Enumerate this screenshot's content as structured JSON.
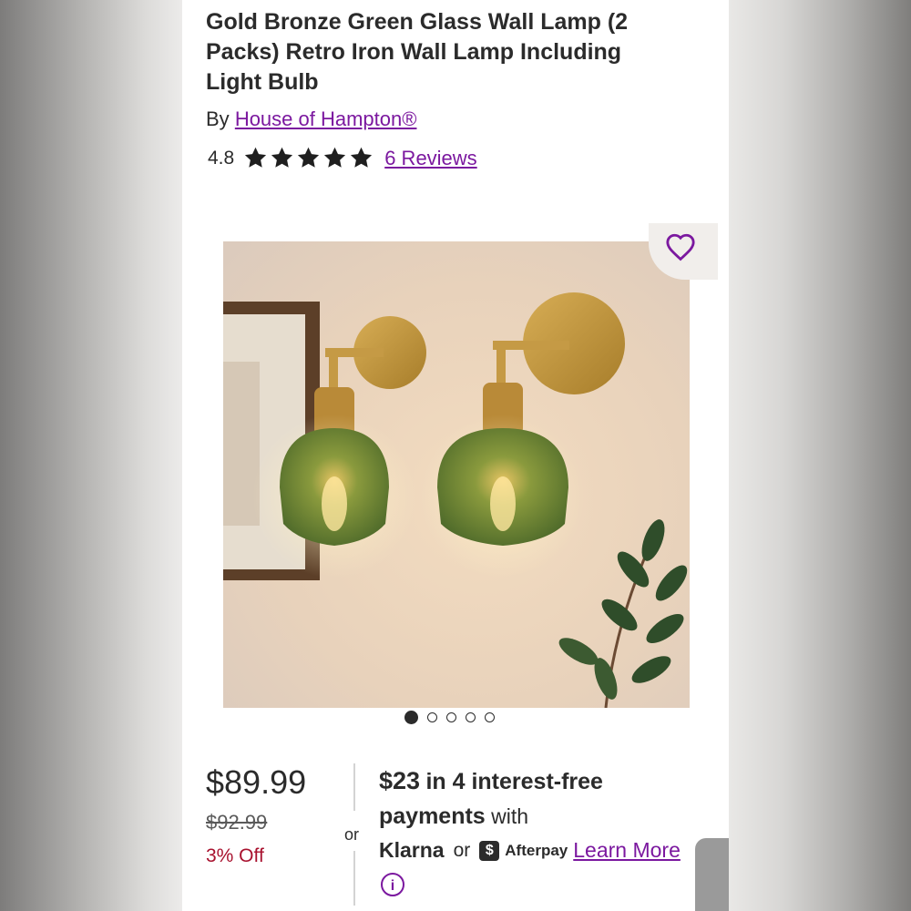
{
  "product": {
    "title": "Gold Bronze Green Glass Wall Lamp (2 Packs) Retro Iron Wall Lamp Including Light Bulb",
    "by_label": "By",
    "brand": "House of Hampton®",
    "rating": "4.8",
    "star_count": 5,
    "reviews_link": "6 Reviews"
  },
  "gallery": {
    "image_count": 5,
    "active_index": 0
  },
  "pricing": {
    "price": "$89.99",
    "old_price": "$92.99",
    "discount": "3% Off",
    "or_label": "or",
    "installment_amount": "$23",
    "installment_text_1": "in 4 interest-free",
    "installment_text_2": "payments",
    "installment_text_3": "with",
    "klarna": "Klarna",
    "or2": "or",
    "afterpay": "Afterpay",
    "learn_more": "Learn More",
    "info_icon": "i"
  },
  "colors": {
    "accent": "#7b189f",
    "discount_red": "#a8112e"
  }
}
